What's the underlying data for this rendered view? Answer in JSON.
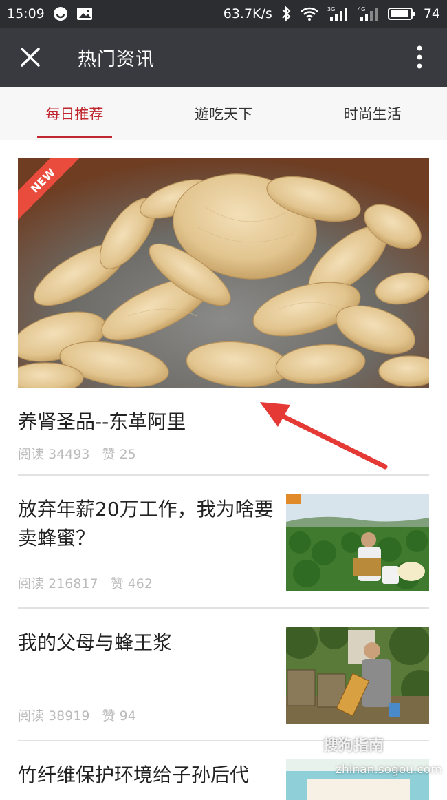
{
  "status_bar": {
    "time": "15:09",
    "speed": "63.7K/s",
    "net_3g": "3G",
    "net_4g": "4G",
    "battery": "74"
  },
  "app_bar": {
    "title": "热门资讯"
  },
  "tabs": [
    {
      "label": "每日推荐",
      "active": true
    },
    {
      "label": "遊吃天下",
      "active": false
    },
    {
      "label": "时尚生活",
      "active": false
    }
  ],
  "hero": {
    "badge": "NEW",
    "title": "养肾圣品--东革阿里",
    "read_label": "阅读",
    "reads": "34493",
    "like_label": "赞",
    "likes": "25"
  },
  "articles": [
    {
      "title": "放弃年薪20万工作，我为啥要卖蜂蜜？",
      "read_label": "阅读",
      "reads": "216817",
      "like_label": "赞",
      "likes": "462"
    },
    {
      "title": "我的父母与蜂王浆",
      "read_label": "阅读",
      "reads": "38919",
      "like_label": "赞",
      "likes": "94"
    },
    {
      "title": "竹纤维保护环境给子孙后代"
    }
  ],
  "watermark": {
    "brand": "搜狗指南",
    "url": "zhinan.sogou.com"
  },
  "colors": {
    "accent": "#c0262d",
    "arrow": "#e53935",
    "statusbar": "#2b2d30",
    "appbar": "#393a3f"
  }
}
